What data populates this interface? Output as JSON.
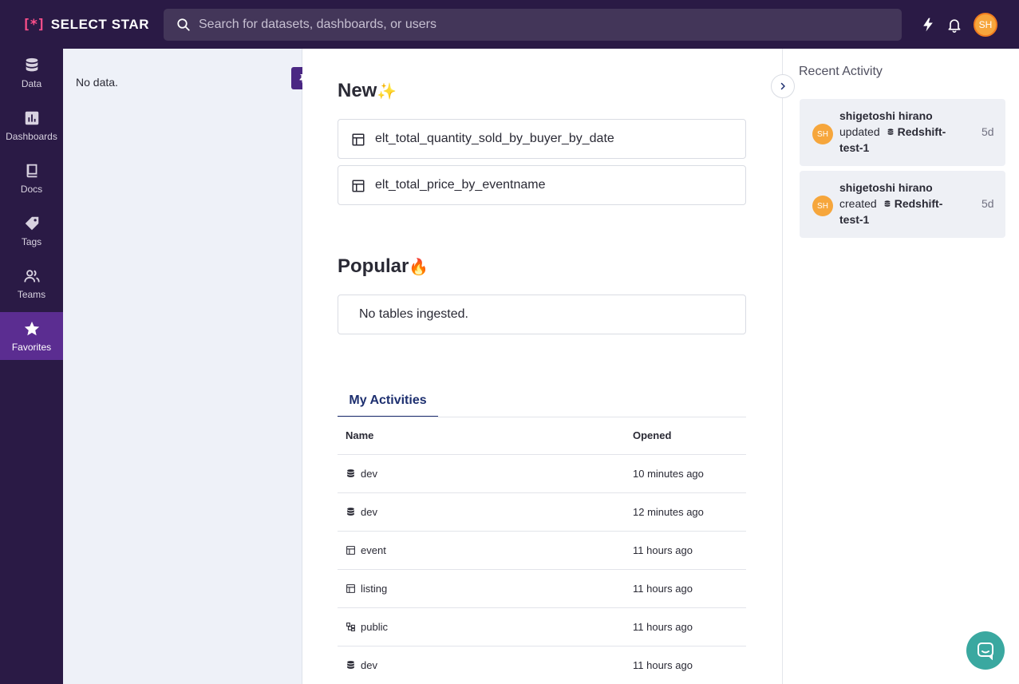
{
  "brand": {
    "mark": "[*]",
    "name": "SELECT STAR"
  },
  "search": {
    "placeholder": "Search for datasets, dashboards, or users"
  },
  "user": {
    "initials": "SH"
  },
  "nav": [
    {
      "label": "Data",
      "icon": "database-icon"
    },
    {
      "label": "Dashboards",
      "icon": "bar-chart-icon"
    },
    {
      "label": "Docs",
      "icon": "book-icon"
    },
    {
      "label": "Tags",
      "icon": "tag-icon"
    },
    {
      "label": "Teams",
      "icon": "users-icon"
    },
    {
      "label": "Favorites",
      "icon": "star-icon",
      "active": true
    }
  ],
  "favorites": {
    "empty_text": "No data."
  },
  "new_section": {
    "title": "New",
    "emoji": "✨",
    "items": [
      {
        "name": "elt_total_quantity_sold_by_buyer_by_date",
        "icon": "table-icon"
      },
      {
        "name": "elt_total_price_by_eventname",
        "icon": "table-icon"
      }
    ]
  },
  "popular_section": {
    "title": "Popular",
    "emoji": "🔥",
    "empty_text": "No tables ingested."
  },
  "activities": {
    "tab_label": "My Activities",
    "columns": {
      "name": "Name",
      "opened": "Opened"
    },
    "rows": [
      {
        "name": "dev",
        "icon": "database-icon",
        "opened": "10 minutes ago"
      },
      {
        "name": "dev",
        "icon": "database-icon",
        "opened": "12 minutes ago"
      },
      {
        "name": "event",
        "icon": "table-icon",
        "opened": "11 hours ago"
      },
      {
        "name": "listing",
        "icon": "table-icon",
        "opened": "11 hours ago"
      },
      {
        "name": "public",
        "icon": "schema-icon",
        "opened": "11 hours ago"
      },
      {
        "name": "dev",
        "icon": "database-icon",
        "opened": "11 hours ago"
      }
    ]
  },
  "recent_activity": {
    "title": "Recent Activity",
    "items": [
      {
        "initials": "SH",
        "user": "shigetoshi hirano",
        "action": "updated",
        "object_part1": "Redshift-",
        "object_part2": "test-1",
        "time": "5d"
      },
      {
        "initials": "SH",
        "user": "shigetoshi hirano",
        "action": "created",
        "object_part1": "Redshift-",
        "object_part2": "test-1",
        "time": "5d"
      }
    ]
  },
  "colors": {
    "sidebar_bg": "#2a1a45",
    "active_nav": "#5b2d91",
    "accent_tab": "#1d2f6f",
    "avatar": "#f6a63c",
    "chat_button": "#3aa8a0"
  }
}
